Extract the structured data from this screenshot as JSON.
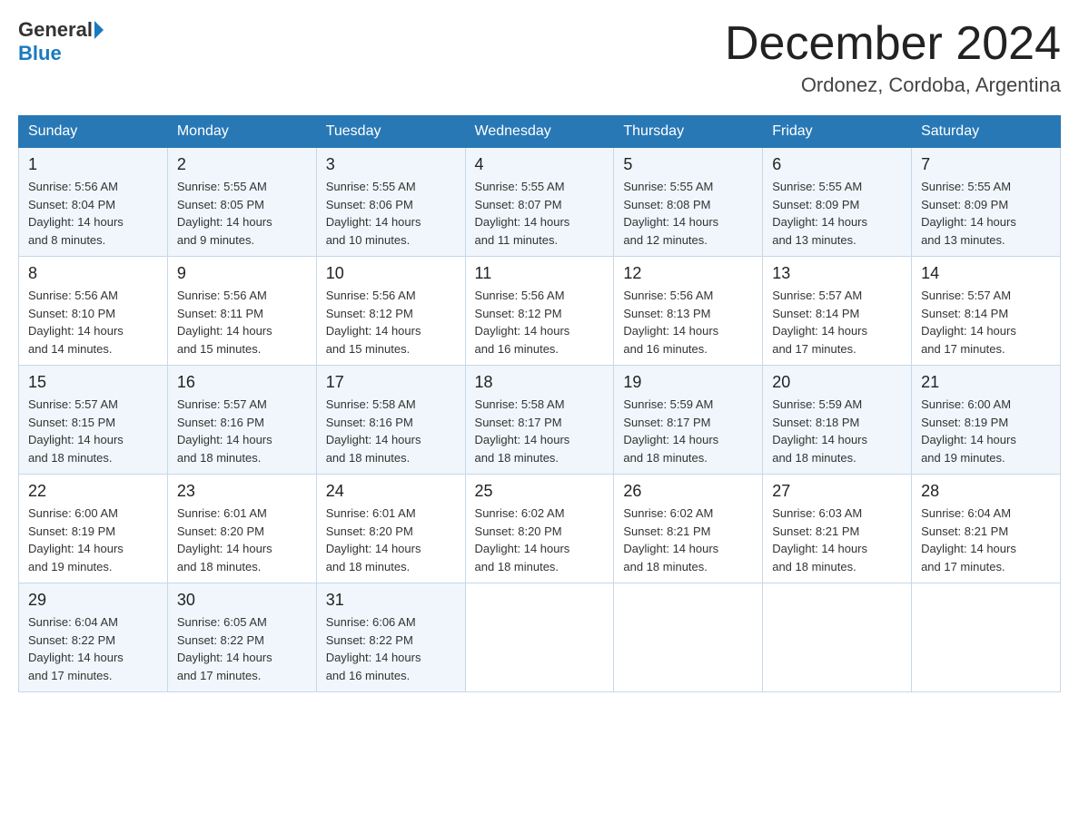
{
  "header": {
    "logo_general": "General",
    "logo_blue": "Blue",
    "month_title": "December 2024",
    "location": "Ordonez, Cordoba, Argentina"
  },
  "days_of_week": [
    "Sunday",
    "Monday",
    "Tuesday",
    "Wednesday",
    "Thursday",
    "Friday",
    "Saturday"
  ],
  "weeks": [
    [
      {
        "day": "1",
        "sunrise": "5:56 AM",
        "sunset": "8:04 PM",
        "daylight": "14 hours and 8 minutes."
      },
      {
        "day": "2",
        "sunrise": "5:55 AM",
        "sunset": "8:05 PM",
        "daylight": "14 hours and 9 minutes."
      },
      {
        "day": "3",
        "sunrise": "5:55 AM",
        "sunset": "8:06 PM",
        "daylight": "14 hours and 10 minutes."
      },
      {
        "day": "4",
        "sunrise": "5:55 AM",
        "sunset": "8:07 PM",
        "daylight": "14 hours and 11 minutes."
      },
      {
        "day": "5",
        "sunrise": "5:55 AM",
        "sunset": "8:08 PM",
        "daylight": "14 hours and 12 minutes."
      },
      {
        "day": "6",
        "sunrise": "5:55 AM",
        "sunset": "8:09 PM",
        "daylight": "14 hours and 13 minutes."
      },
      {
        "day": "7",
        "sunrise": "5:55 AM",
        "sunset": "8:09 PM",
        "daylight": "14 hours and 13 minutes."
      }
    ],
    [
      {
        "day": "8",
        "sunrise": "5:56 AM",
        "sunset": "8:10 PM",
        "daylight": "14 hours and 14 minutes."
      },
      {
        "day": "9",
        "sunrise": "5:56 AM",
        "sunset": "8:11 PM",
        "daylight": "14 hours and 15 minutes."
      },
      {
        "day": "10",
        "sunrise": "5:56 AM",
        "sunset": "8:12 PM",
        "daylight": "14 hours and 15 minutes."
      },
      {
        "day": "11",
        "sunrise": "5:56 AM",
        "sunset": "8:12 PM",
        "daylight": "14 hours and 16 minutes."
      },
      {
        "day": "12",
        "sunrise": "5:56 AM",
        "sunset": "8:13 PM",
        "daylight": "14 hours and 16 minutes."
      },
      {
        "day": "13",
        "sunrise": "5:57 AM",
        "sunset": "8:14 PM",
        "daylight": "14 hours and 17 minutes."
      },
      {
        "day": "14",
        "sunrise": "5:57 AM",
        "sunset": "8:14 PM",
        "daylight": "14 hours and 17 minutes."
      }
    ],
    [
      {
        "day": "15",
        "sunrise": "5:57 AM",
        "sunset": "8:15 PM",
        "daylight": "14 hours and 18 minutes."
      },
      {
        "day": "16",
        "sunrise": "5:57 AM",
        "sunset": "8:16 PM",
        "daylight": "14 hours and 18 minutes."
      },
      {
        "day": "17",
        "sunrise": "5:58 AM",
        "sunset": "8:16 PM",
        "daylight": "14 hours and 18 minutes."
      },
      {
        "day": "18",
        "sunrise": "5:58 AM",
        "sunset": "8:17 PM",
        "daylight": "14 hours and 18 minutes."
      },
      {
        "day": "19",
        "sunrise": "5:59 AM",
        "sunset": "8:17 PM",
        "daylight": "14 hours and 18 minutes."
      },
      {
        "day": "20",
        "sunrise": "5:59 AM",
        "sunset": "8:18 PM",
        "daylight": "14 hours and 18 minutes."
      },
      {
        "day": "21",
        "sunrise": "6:00 AM",
        "sunset": "8:19 PM",
        "daylight": "14 hours and 19 minutes."
      }
    ],
    [
      {
        "day": "22",
        "sunrise": "6:00 AM",
        "sunset": "8:19 PM",
        "daylight": "14 hours and 19 minutes."
      },
      {
        "day": "23",
        "sunrise": "6:01 AM",
        "sunset": "8:20 PM",
        "daylight": "14 hours and 18 minutes."
      },
      {
        "day": "24",
        "sunrise": "6:01 AM",
        "sunset": "8:20 PM",
        "daylight": "14 hours and 18 minutes."
      },
      {
        "day": "25",
        "sunrise": "6:02 AM",
        "sunset": "8:20 PM",
        "daylight": "14 hours and 18 minutes."
      },
      {
        "day": "26",
        "sunrise": "6:02 AM",
        "sunset": "8:21 PM",
        "daylight": "14 hours and 18 minutes."
      },
      {
        "day": "27",
        "sunrise": "6:03 AM",
        "sunset": "8:21 PM",
        "daylight": "14 hours and 18 minutes."
      },
      {
        "day": "28",
        "sunrise": "6:04 AM",
        "sunset": "8:21 PM",
        "daylight": "14 hours and 17 minutes."
      }
    ],
    [
      {
        "day": "29",
        "sunrise": "6:04 AM",
        "sunset": "8:22 PM",
        "daylight": "14 hours and 17 minutes."
      },
      {
        "day": "30",
        "sunrise": "6:05 AM",
        "sunset": "8:22 PM",
        "daylight": "14 hours and 17 minutes."
      },
      {
        "day": "31",
        "sunrise": "6:06 AM",
        "sunset": "8:22 PM",
        "daylight": "14 hours and 16 minutes."
      },
      null,
      null,
      null,
      null
    ]
  ],
  "labels": {
    "sunrise": "Sunrise:",
    "sunset": "Sunset:",
    "daylight": "Daylight:"
  }
}
